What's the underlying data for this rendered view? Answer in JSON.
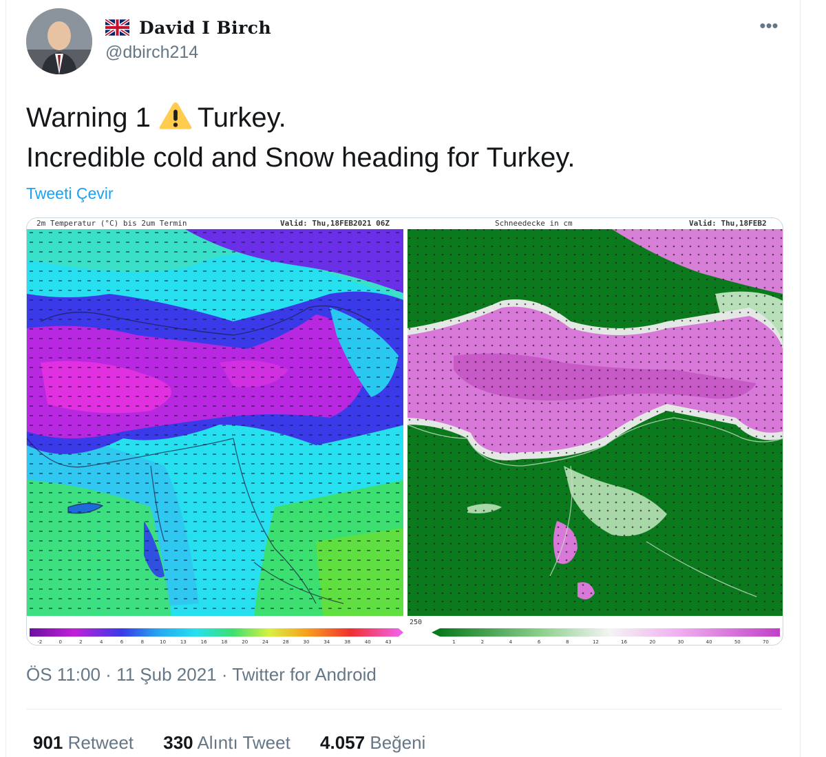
{
  "author": {
    "flag_icon": "uk-flag-icon",
    "display_name": "David I Birch",
    "handle": "@dbirch214"
  },
  "more_icon": "more-horizontal-icon",
  "more_label": "•••",
  "tweet": {
    "line1_before": "Warning 1",
    "warning_icon": "warning-sign-icon",
    "line1_after": "Turkey.",
    "line2": "Incredible cold and Snow heading for Turkey."
  },
  "translate_label": "Tweeti Çevir",
  "media": {
    "left_map": {
      "title": "2m Temperatur (°C) bis 2um Termin",
      "valid": "Valid: Thu,18FEB2021 06Z",
      "scale_labels": [
        "-2",
        "0",
        "2",
        "4",
        "6",
        "8",
        "10",
        "13",
        "16",
        "18",
        "20",
        "24",
        "28",
        "30",
        "34",
        "38",
        "40",
        "43"
      ]
    },
    "right_map": {
      "title": "Schneedecke in cm",
      "valid": "Valid: Thu,18FEB2",
      "corner_label": "250",
      "scale_labels": [
        "1",
        "2",
        "4",
        "6",
        "8",
        "12",
        "16",
        "20",
        "30",
        "40",
        "50",
        "70"
      ]
    }
  },
  "meta": {
    "time": "ÖS 11:00",
    "date": "11 Şub 2021",
    "source": "Twitter for Android",
    "separator": "·"
  },
  "stats": {
    "retweets_count": "901",
    "retweets_label": "Retweet",
    "quotes_count": "330",
    "quotes_label": "Alıntı Tweet",
    "likes_count": "4.057",
    "likes_label": "Beğeni"
  },
  "colors": {
    "link": "#1da1f2",
    "secondary_text": "#657786",
    "snow_green": "#0b7a1d",
    "snow_magenta": "#d878d8",
    "cold_magenta": "#c020d8",
    "cold_blue": "#3a3ae8",
    "cyan": "#26e0f0",
    "warm_green": "#3ce070"
  }
}
